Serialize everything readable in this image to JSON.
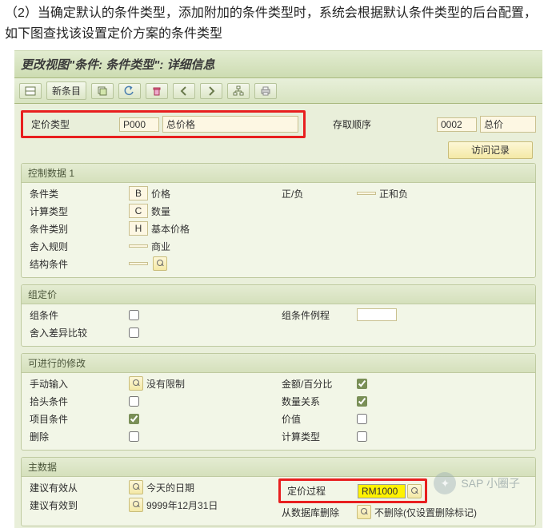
{
  "intro": "（2）当确定默认的条件类型，添加附加的条件类型时，系统会根据默认条件类型的后台配置，如下图查找该设置定价方案的条件类型",
  "title": "更改视图\"条件: 条件类型\": 详细信息",
  "toolbar": {
    "newEntries": "新条目"
  },
  "header": {
    "pricingType": {
      "label": "定价类型",
      "code": "P000",
      "desc": "总价格"
    },
    "accessSeq": {
      "label": "存取顺序",
      "code": "0002",
      "desc": "总价"
    },
    "accessLogBtn": "访问记录"
  },
  "panels": {
    "ctrl": {
      "title": "控制数据 1",
      "condClass": {
        "label": "条件类",
        "code": "B",
        "desc": "价格"
      },
      "calcType": {
        "label": "计算类型",
        "code": "C",
        "desc": "数量"
      },
      "condCat": {
        "label": "条件类别",
        "code": "H",
        "desc": "基本价格"
      },
      "rounding": {
        "label": "舍入规则",
        "code": "",
        "desc": "商业"
      },
      "struct": {
        "label": "结构条件",
        "code": ""
      },
      "sign": {
        "label": "正/负",
        "code": "",
        "desc": "正和负"
      }
    },
    "group": {
      "title": "组定价",
      "groupCond": {
        "label": "组条件"
      },
      "groupRout": {
        "label": "组条件例程"
      },
      "diffCmp": {
        "label": "舍入差异比较"
      }
    },
    "mod": {
      "title": "可进行的修改",
      "manual": {
        "label": "手动输入",
        "desc": "没有限制"
      },
      "headCond": {
        "label": "拾头条件"
      },
      "itemCond": {
        "label": "项目条件"
      },
      "delete": {
        "label": "删除"
      },
      "amtPct": {
        "label": "金额/百分比"
      },
      "qtyRel": {
        "label": "数量关系"
      },
      "value": {
        "label": "价值"
      },
      "calcType": {
        "label": "计算类型"
      }
    },
    "master": {
      "title": "主数据",
      "validFrom": {
        "label": "建议有效从",
        "desc": "今天的日期"
      },
      "validTo": {
        "label": "建议有效到",
        "desc": "9999年12月31日"
      },
      "pricingProc": {
        "label": "定价过程",
        "code": "RM1000"
      },
      "delDb": {
        "label": "从数据库删除",
        "desc": "不删除(仅设置删除标记)"
      }
    }
  },
  "watermark": "SAP 小圈子"
}
